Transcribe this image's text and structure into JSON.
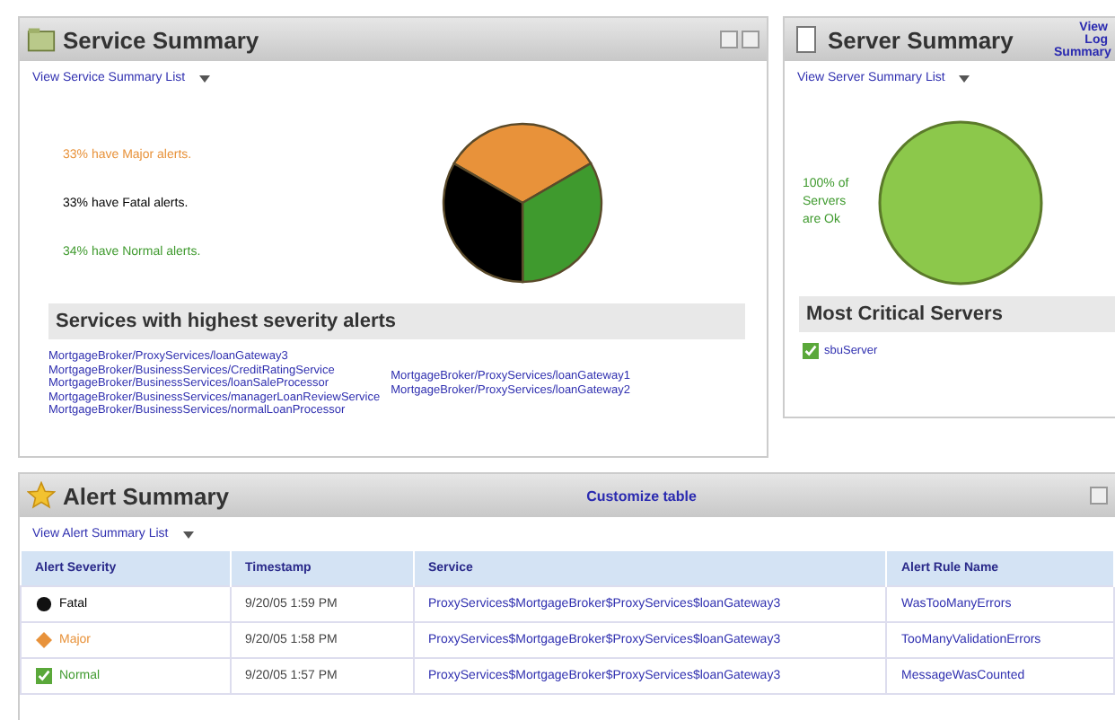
{
  "service_summary": {
    "title": "Service Summary",
    "list_link": "View Service Summary List",
    "legend": [
      {
        "text": "33% have Major alerts.",
        "color": "#e8923a"
      },
      {
        "text": "33% have Fatal alerts.",
        "color": "#000000"
      },
      {
        "text": "34% have Normal alerts.",
        "color": "#3f9a2e"
      }
    ],
    "severity_heading": "Services with highest severity alerts",
    "services_left": [
      "MortgageBroker/ProxyServices/loanGateway3",
      "MortgageBroker/BusinessServices/CreditRatingService",
      "MortgageBroker/BusinessServices/loanSaleProcessor",
      "MortgageBroker/BusinessServices/managerLoanReviewService",
      "MortgageBroker/BusinessServices/normalLoanProcessor"
    ],
    "services_right": [
      "MortgageBroker/ProxyServices/loanGateway1",
      "MortgageBroker/ProxyServices/loanGateway2"
    ]
  },
  "server_summary": {
    "title": "Server Summary",
    "log_link": "View Log Summary",
    "list_link": "View Server Summary List",
    "status_text": "100% of Servers are Ok",
    "critical_heading": "Most Critical Servers",
    "servers": [
      "sbuServer"
    ]
  },
  "alert_summary": {
    "title": "Alert Summary",
    "customize_link": "Customize table",
    "list_link": "View Alert Summary List",
    "columns": [
      "Alert Severity",
      "Timestamp",
      "Service",
      "Alert Rule Name"
    ],
    "rows": [
      {
        "kind": "fatal",
        "severity": "Fatal",
        "timestamp": "9/20/05 1:59 PM",
        "service": "ProxyServices$MortgageBroker$ProxyServices$loanGateway3",
        "rule": "WasTooManyErrors"
      },
      {
        "kind": "major",
        "severity": "Major",
        "timestamp": "9/20/05 1:58 PM",
        "service": "ProxyServices$MortgageBroker$ProxyServices$loanGateway3",
        "rule": "TooManyValidationErrors"
      },
      {
        "kind": "normal",
        "severity": "Normal",
        "timestamp": "9/20/05 1:57 PM",
        "service": "ProxyServices$MortgageBroker$ProxyServices$loanGateway3",
        "rule": "MessageWasCounted"
      }
    ]
  }
}
